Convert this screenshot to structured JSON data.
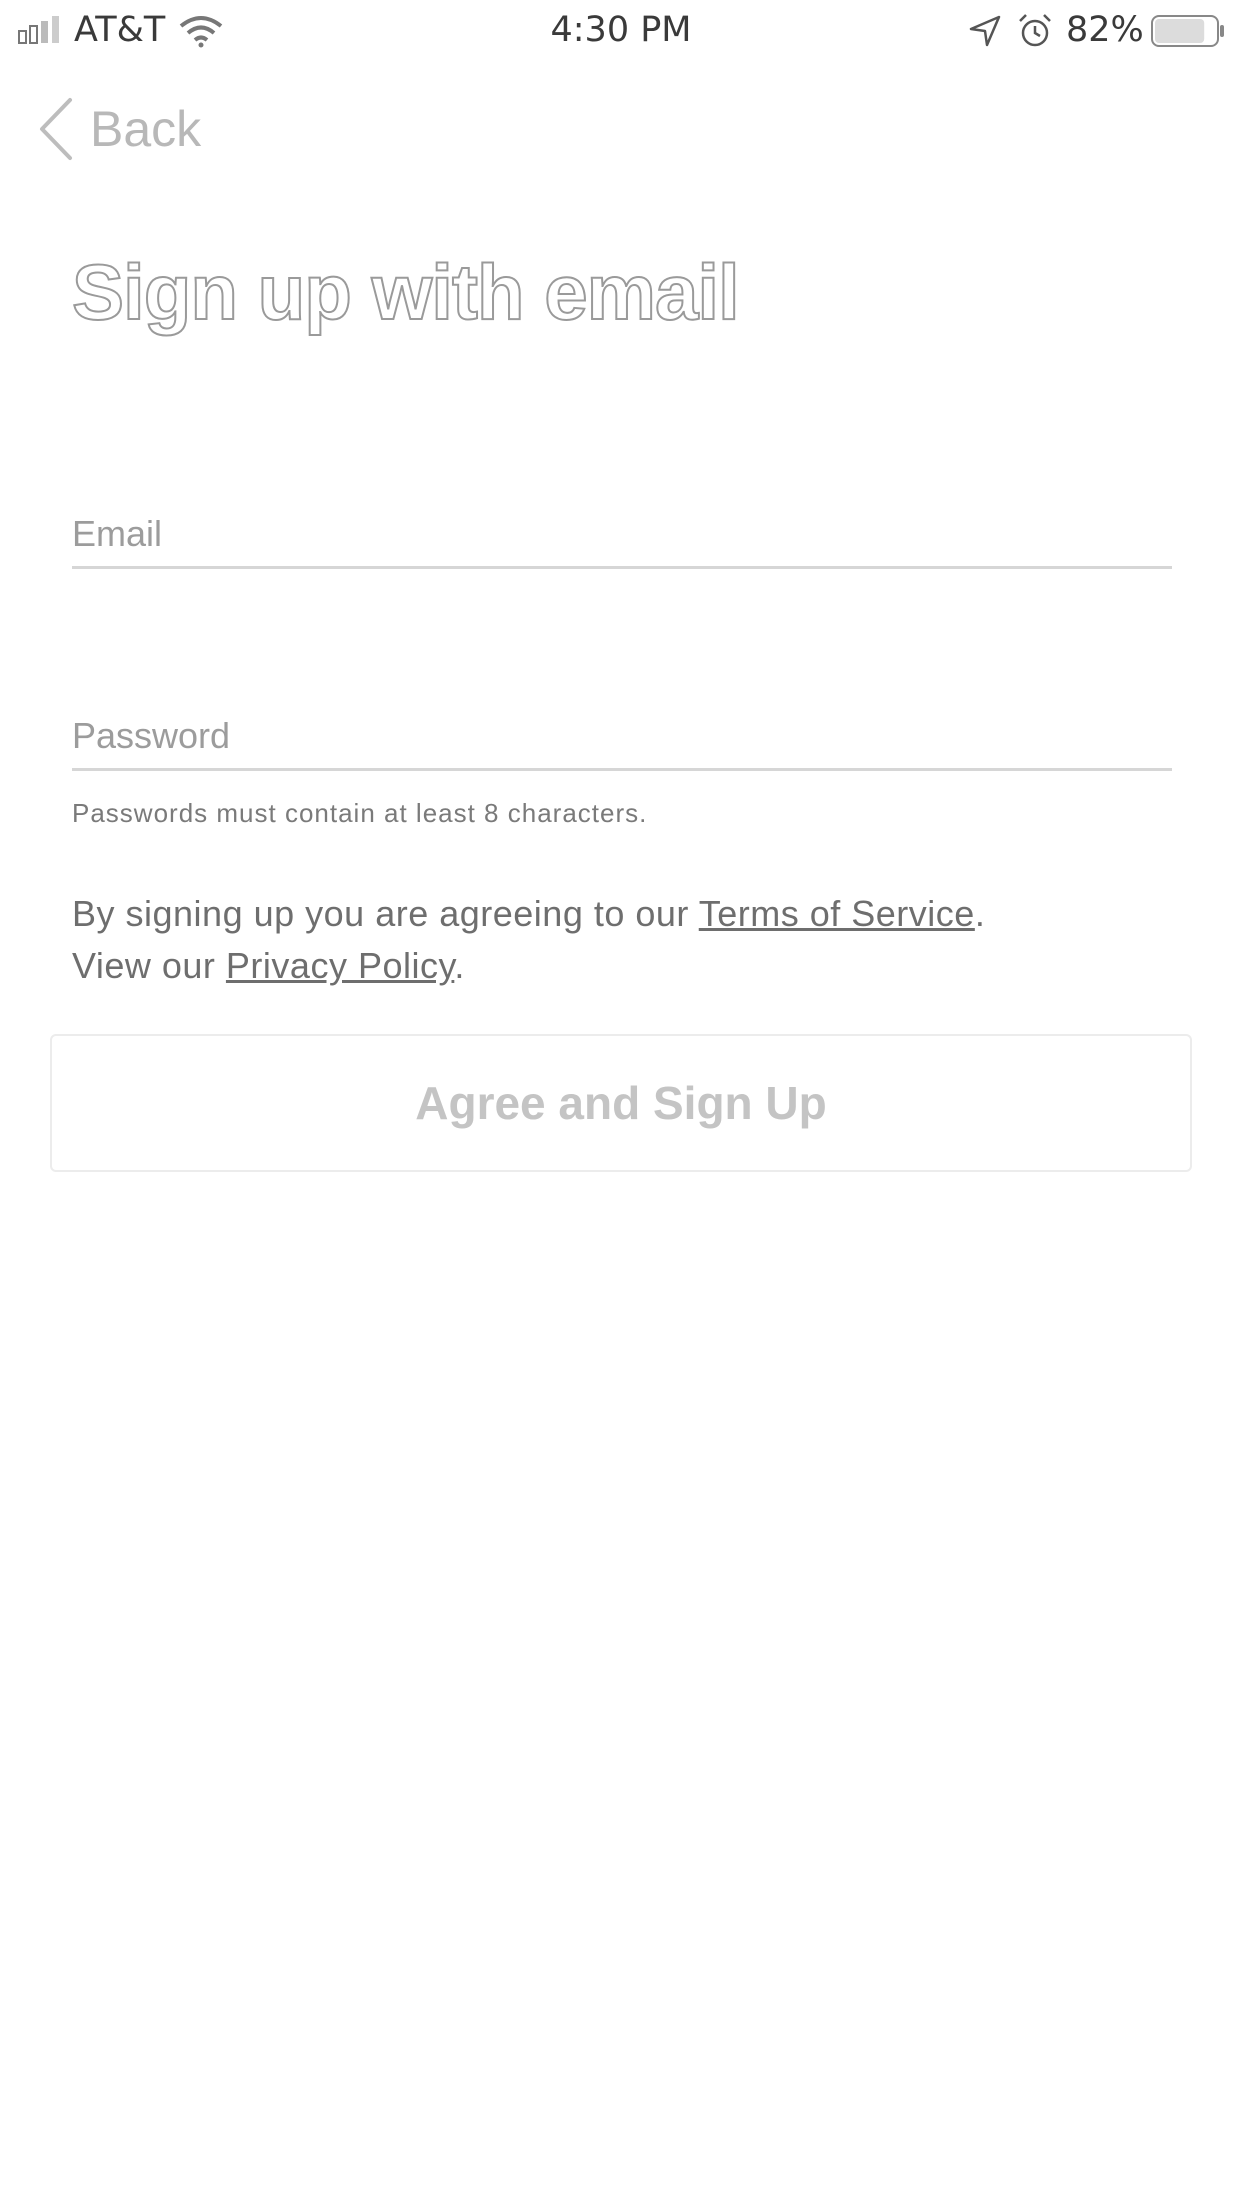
{
  "status_bar": {
    "carrier": "AT&T",
    "time": "4:30 PM",
    "battery_percent": "82%",
    "battery_level": 0.82,
    "icons": [
      "signal-icon",
      "wifi-icon",
      "location-icon",
      "alarm-icon",
      "battery-icon"
    ]
  },
  "nav": {
    "back_label": "Back",
    "back_icon": "chevron-left-icon"
  },
  "page": {
    "title": "Sign up with email"
  },
  "form": {
    "email_placeholder": "Email",
    "email_value": "",
    "password_placeholder": "Password",
    "password_value": "",
    "password_hint": "Passwords must contain at least 8 characters."
  },
  "agreement": {
    "line1_prefix": "By signing up you are agreeing to our ",
    "terms_link": "Terms of Service",
    "line1_suffix": ".",
    "line2_prefix": "View our ",
    "privacy_link": "Privacy Policy",
    "line2_suffix": "."
  },
  "actions": {
    "signup_label": "Agree and Sign Up"
  },
  "colors": {
    "background": "#ffffff",
    "text_muted": "#9c9c9c",
    "title_outline": "#9a9a9a",
    "button_text": "#c4c4c4"
  }
}
